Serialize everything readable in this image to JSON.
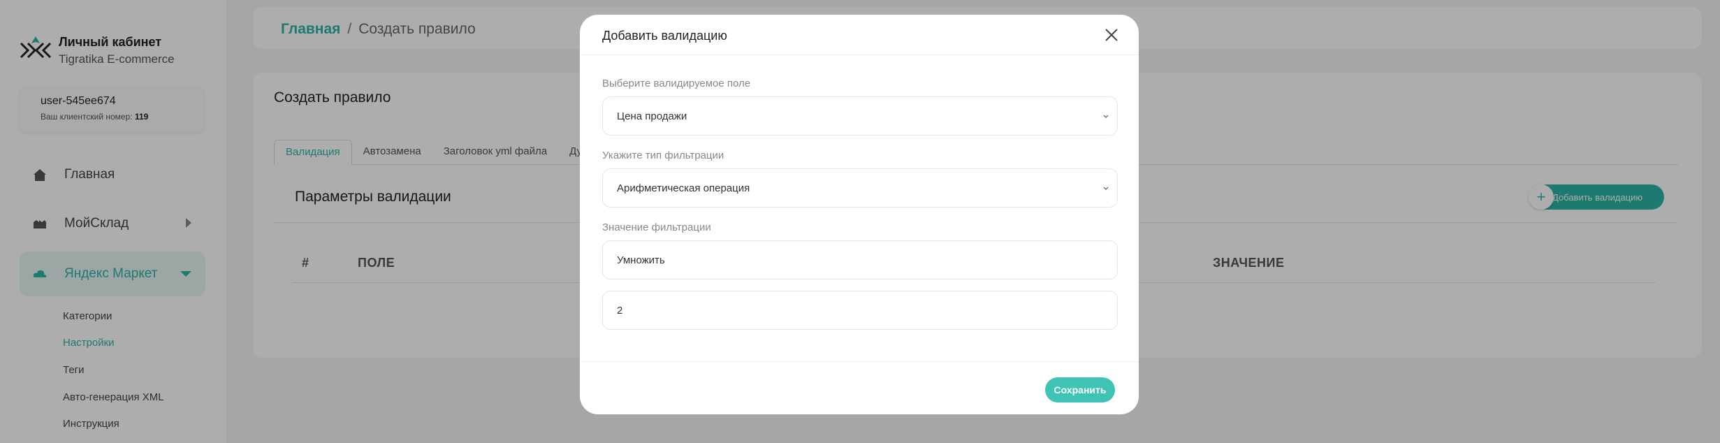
{
  "brand": {
    "title": "Личный кабинет",
    "subtitle": "Tigratika E-commerce"
  },
  "user": {
    "name": "user-545ee674",
    "client_label": "Ваш клиентский номер:",
    "client_number": "119"
  },
  "nav": {
    "home": "Главная",
    "moysklad": "МойСклад",
    "yandex": "Яндекс Маркет",
    "sub": [
      "Категории",
      "Настройки",
      "Теги",
      "Авто-генерация XML",
      "Инструкция"
    ]
  },
  "breadcrumb": {
    "home": "Главная",
    "separator": "/",
    "current": "Создать правило"
  },
  "main": {
    "title": "Создать правило",
    "tabs": [
      "Валидация",
      "Автозамена",
      "Заголовок yml файла",
      "Дубл"
    ],
    "params_title": "Параметры валидации",
    "add_button": "Добавить валидацию",
    "add_icon": "+",
    "table_headers": {
      "num": "#",
      "field": "ПОЛЕ",
      "value": "ЗНАЧЕНИЕ"
    }
  },
  "modal": {
    "title": "Добавить валидацию",
    "field_label": "Выберите валидируемое поле",
    "field_value": "Цена продажи",
    "filter_type_label": "Укажите тип фильтрации",
    "filter_type_value": "Арифметическая операция",
    "filter_value_label": "Значение фильтрации",
    "filter_operation": "Умножить",
    "filter_number": "2",
    "save": "Сохранить"
  },
  "colors": {
    "accent": "#2bb4a7",
    "overlay": "rgba(0,0,0,0.32)"
  }
}
